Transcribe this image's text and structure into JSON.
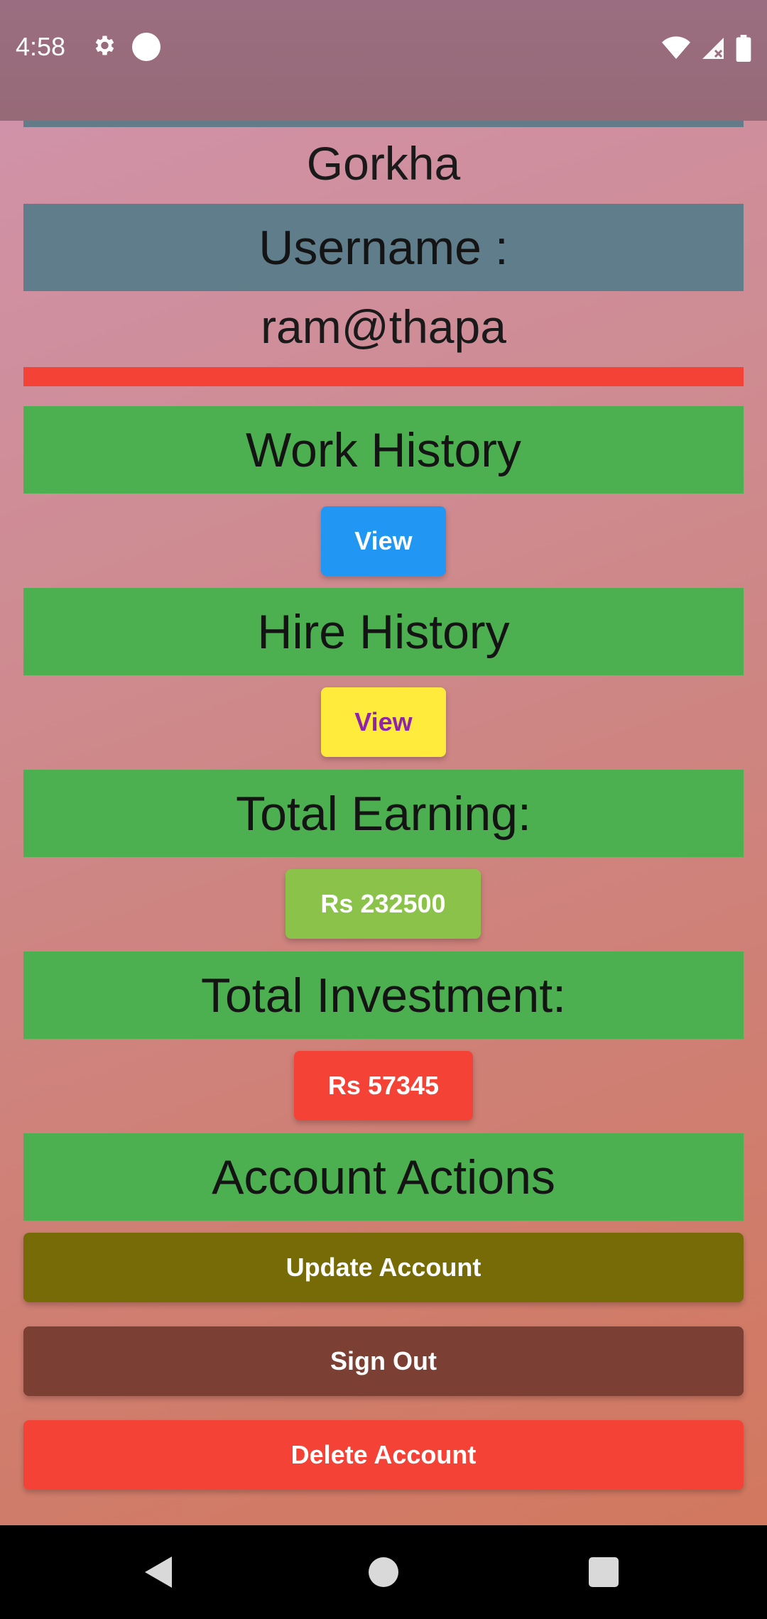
{
  "status_bar": {
    "time": "4:58",
    "icons": [
      "gear-icon",
      "circle-icon",
      "wifi-icon",
      "signal-icon",
      "battery-icon"
    ]
  },
  "profile": {
    "location": "Gorkha",
    "username_label": "Username :",
    "username": "ram@thapa"
  },
  "sections": {
    "work_history": {
      "title": "Work History",
      "button": "View"
    },
    "hire_history": {
      "title": "Hire History",
      "button": "View"
    },
    "total_earning": {
      "title": "Total Earning:",
      "value": "Rs 232500"
    },
    "total_investment": {
      "title": "Total Investment:",
      "value": "Rs 57345"
    },
    "account_actions": {
      "title": "Account Actions",
      "update": "Update Account",
      "sign_out": "Sign Out",
      "delete": "Delete Account"
    }
  },
  "colors": {
    "heading_green": "#4caf50",
    "username_bar": "#607d8b",
    "divider_red": "#f44336",
    "view_blue": "#2196f3",
    "view_yellow": "#ffeb3b",
    "earning_green": "#8bc34a",
    "investment_red": "#f44336",
    "update_olive": "#776b08",
    "signout_brown": "#7b4033",
    "delete_red": "#f44336"
  },
  "nav_bar": {
    "icons": [
      "back-icon",
      "home-icon",
      "recents-icon"
    ]
  }
}
